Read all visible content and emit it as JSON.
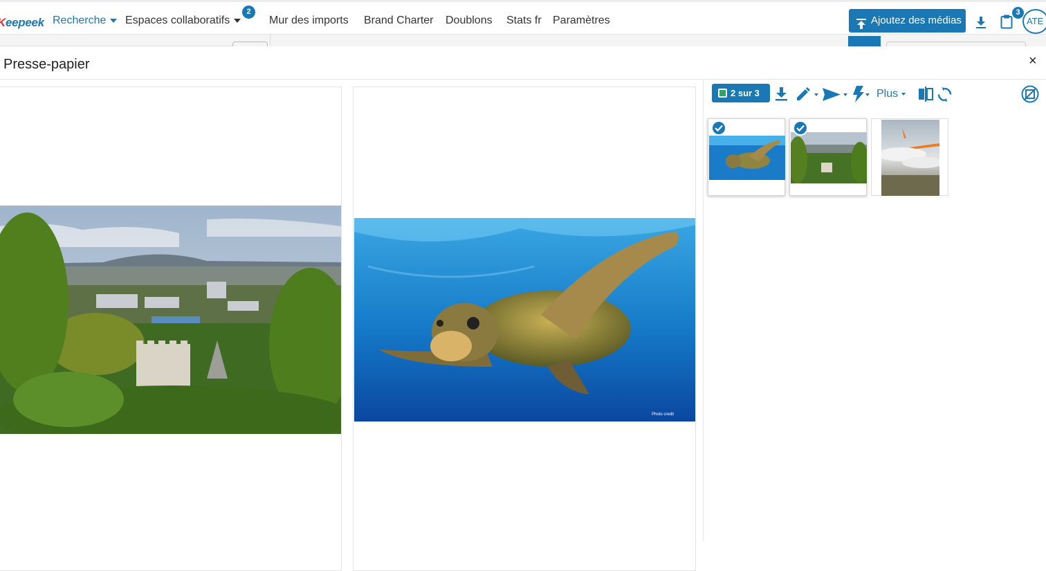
{
  "app": {
    "logo_prefix": "K",
    "logo_rest": "eepeek"
  },
  "nav": {
    "items": [
      {
        "label": "Recherche"
      },
      {
        "label": "Espaces collaboratifs",
        "badge": "2"
      },
      {
        "label": "Mur des imports"
      },
      {
        "label": "Brand Charter"
      },
      {
        "label": "Doublons"
      },
      {
        "label": "Stats fr"
      },
      {
        "label": "Paramètres"
      }
    ],
    "upload_label": "Ajoutez des médias",
    "clipboard_badge": "3",
    "avatar": "ATE"
  },
  "panel": {
    "title": "Presse-papier",
    "close": "×",
    "viewers": [
      {
        "subject": "castle-landscape"
      },
      {
        "subject": "sea-turtle",
        "watermark": "Photo credit"
      }
    ],
    "toolbar": {
      "selection_label": "2 sur 3",
      "more_label": "Plus"
    },
    "thumbnails": [
      {
        "subject": "sea-turtle",
        "selected": true
      },
      {
        "subject": "castle-landscape",
        "selected": true
      },
      {
        "subject": "airplane-wing",
        "selected": false
      }
    ]
  },
  "colors": {
    "accent": "#1a78b4",
    "logo_red": "#e4312f",
    "check_green": "#2ea36b"
  },
  "icons": [
    "download-icon",
    "clipboard-icon",
    "upload-icon",
    "pencil-icon",
    "send-icon",
    "lightning-icon",
    "compare-icon",
    "refresh-icon",
    "hide-image-icon",
    "checkmark-icon",
    "close-icon"
  ]
}
